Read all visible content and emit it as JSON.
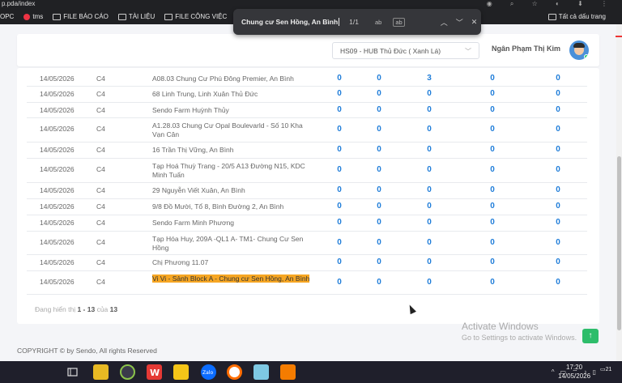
{
  "browser": {
    "url_fragment": "p.pda/index",
    "bookmarks": [
      {
        "label": "OPC",
        "icon": "none"
      },
      {
        "label": "tms",
        "icon": "tms-icon"
      },
      {
        "label": "FILE BÁO CÁO",
        "icon": "folder-icon"
      },
      {
        "label": "TÀI LIỆU",
        "icon": "folder-icon"
      },
      {
        "label": "FILE CÔNG VIỆC",
        "icon": "folder-icon"
      }
    ],
    "all_bookmarks": "Tất cả dấu trang"
  },
  "findbar": {
    "query": "Chung cư Sen Hồng, An Bình",
    "count": "1/1",
    "opt1": "ab",
    "opt2": "ab"
  },
  "header": {
    "hub": "HS09 - HUB Thủ Đức ( Xanh Lá)",
    "username": "Ngân Phạm Thị Kim"
  },
  "rows": [
    {
      "date": "14/05/2026",
      "type": "C4",
      "addr": "A08.03 Chung Cư Phú Đông Premier, An Bình",
      "v": [
        "0",
        "0",
        "3",
        "0",
        "0"
      ]
    },
    {
      "date": "14/05/2026",
      "type": "C4",
      "addr": "68 Linh Trung, Linh Xuân Thủ Đức",
      "v": [
        "0",
        "0",
        "0",
        "0",
        "0"
      ]
    },
    {
      "date": "14/05/2026",
      "type": "C4",
      "addr": "Sendo Farm Huỳnh Thủy",
      "v": [
        "0",
        "0",
        "0",
        "0",
        "0"
      ]
    },
    {
      "date": "14/05/2026",
      "type": "C4",
      "addr": "A1.28.03 Chung Cư Opal Boulevarld - Số 10 Kha Vạn Cân",
      "v": [
        "0",
        "0",
        "0",
        "0",
        "0"
      ]
    },
    {
      "date": "14/05/2026",
      "type": "C4",
      "addr": "16 Trần Thị Vững, An Bình",
      "v": [
        "0",
        "0",
        "0",
        "0",
        "0"
      ]
    },
    {
      "date": "14/05/2026",
      "type": "C4",
      "addr": "Tạp Hoá Thuỳ Trang - 20/5 A13 Đường N15, KDC Minh Tuấn",
      "v": [
        "0",
        "0",
        "0",
        "0",
        "0"
      ]
    },
    {
      "date": "14/05/2026",
      "type": "C4",
      "addr": "29 Nguyễn Viết Xuân, An Bình",
      "v": [
        "0",
        "0",
        "0",
        "0",
        "0"
      ]
    },
    {
      "date": "14/05/2026",
      "type": "C4",
      "addr": "9/8 Đồ Mười, Tổ 8, Bình Đường 2, An Bình",
      "v": [
        "0",
        "0",
        "0",
        "0",
        "0"
      ]
    },
    {
      "date": "14/05/2026",
      "type": "C4",
      "addr": "Sendo Farm Minh Phương",
      "v": [
        "0",
        "0",
        "0",
        "0",
        "0"
      ]
    },
    {
      "date": "14/05/2026",
      "type": "C4",
      "addr": "Tạp Hóa Huy, 209A -QL1 A- TM1- Chung Cư Sen Hồng",
      "v": [
        "0",
        "0",
        "0",
        "0",
        "0"
      ]
    },
    {
      "date": "14/05/2026",
      "type": "C4",
      "addr": "Chị Phương 11.07",
      "v": [
        "0",
        "0",
        "0",
        "0",
        "0"
      ]
    },
    {
      "date": "14/05/2026",
      "type": "C4",
      "addr": "Vi Vi - Sảnh Block A - Chung cư Sen Hồng, An Bình",
      "v": [
        "0",
        "0",
        "0",
        "0",
        "0"
      ],
      "highlight": true
    }
  ],
  "pager": {
    "prefix": "Đang hiển thị ",
    "range": "1 - 13",
    "mid": " của ",
    "total": "13"
  },
  "footer": "COPYRIGHT © by Sendo, All rights Reserved",
  "activate": {
    "line1": "Activate Windows",
    "line2": "Go to Settings to activate Windows."
  },
  "clock": {
    "time": "17:20",
    "date": "14/05/2026"
  },
  "notif_count": "21",
  "colors": {
    "number": "#1f7dd9",
    "highlight": "#f6a623",
    "scroll_top": "#2ebd6b"
  }
}
